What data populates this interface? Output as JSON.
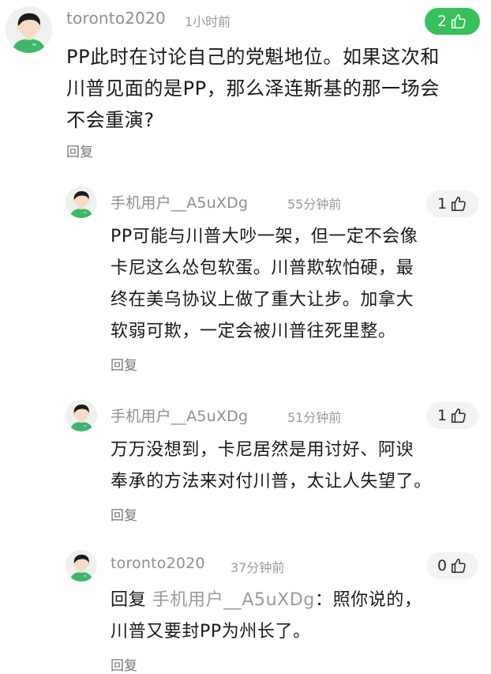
{
  "comments": [
    {
      "username": "toronto2020",
      "time": "1小时前",
      "likes": "2",
      "liked": true,
      "text_lines": [
        "PP此时在讨论自己的党魁地位。如果这次和",
        "川普见面的是PP，那么泽连斯基的那一场会",
        "不会重演?"
      ],
      "reply_label": "回复"
    },
    {
      "username": "手机用户__A5uXDg",
      "time": "55分钟前",
      "likes": "1",
      "liked": false,
      "text_lines": [
        "PP可能与川普大吵一架，但一定不会像",
        "卡尼这么怂包软蛋。川普欺软怕硬，最",
        "终在美乌协议上做了重大让步。加拿大",
        "软弱可欺，一定会被川普往死里整。"
      ],
      "reply_label": "回复"
    },
    {
      "username": "手机用户__A5uXDg",
      "time": "51分钟前",
      "likes": "1",
      "liked": false,
      "text_lines": [
        "万万没想到，卡尼居然是用讨好、阿谀",
        "奉承的方法来对付川普，太让人失望了。"
      ],
      "reply_label": "回复"
    },
    {
      "username": "toronto2020",
      "time": "37分钟前",
      "likes": "0",
      "liked": false,
      "reply_prefix": "回复",
      "reply_to": "手机用户__A5uXDg",
      "text_line_1_rest": "：照你说的，",
      "text_lines": [
        "川普又要封PP为州长了。"
      ],
      "reply_label": "回复"
    }
  ],
  "colors": {
    "accent_green": "#35c25a",
    "avatar_shirt": "#3cb868",
    "avatar_hair": "#1c1c1c",
    "avatar_skin": "#f6dcc7"
  },
  "icons": {
    "like": "thumbs-up-icon",
    "avatar": "default-user-avatar-icon"
  }
}
